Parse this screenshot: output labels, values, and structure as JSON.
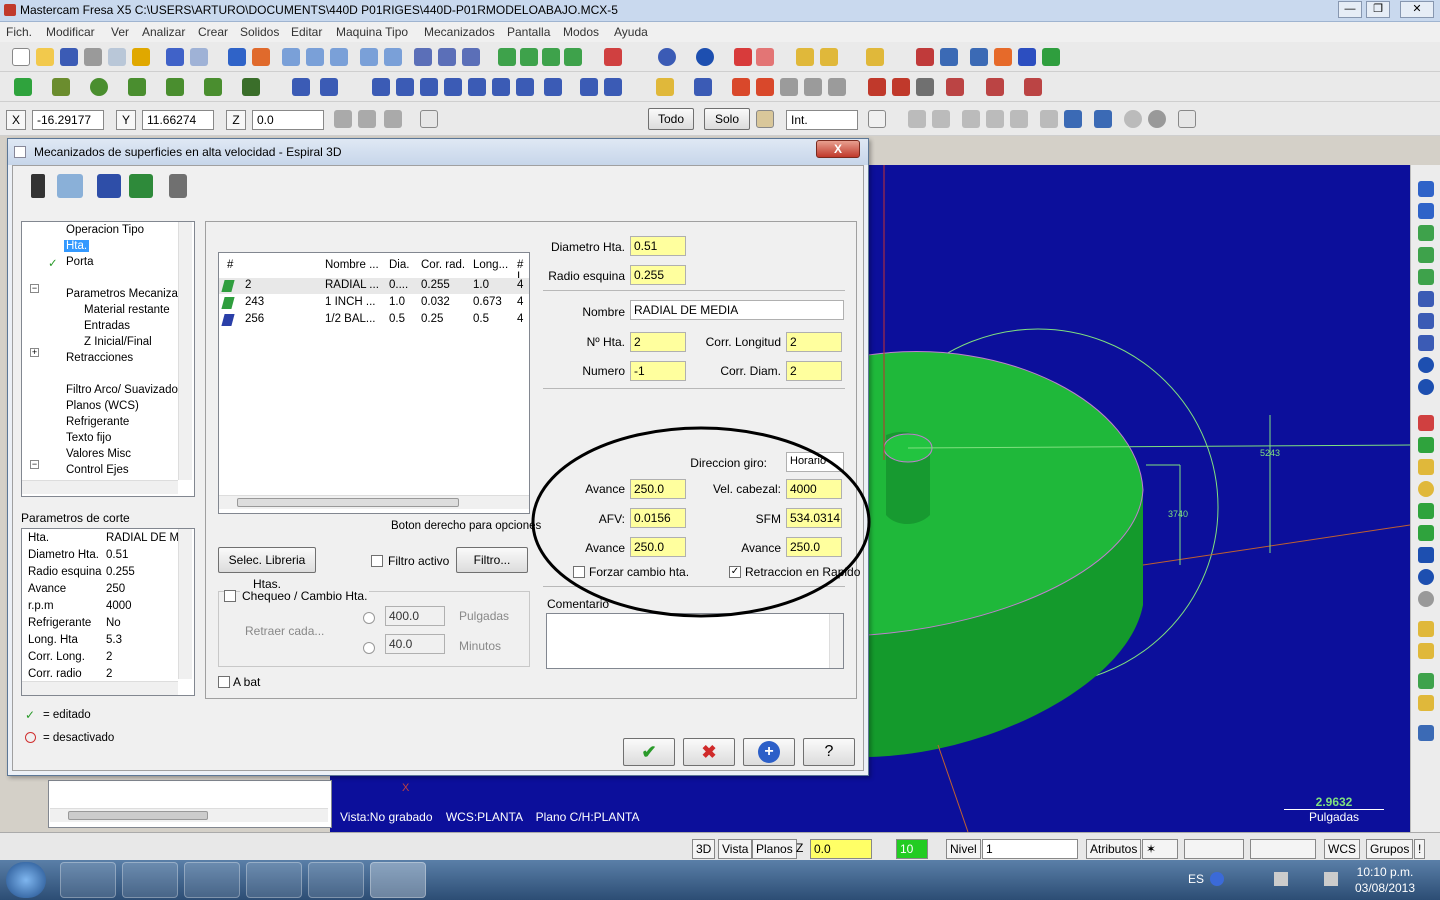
{
  "window": {
    "title": "Mastercam Fresa X5  C:\\USERS\\ARTURO\\DOCUMENTS\\440D P01RIGES\\440D-P01RMODELOABAJO.MCX-5"
  },
  "menu": [
    "Fich.",
    "Modificar",
    "Ver",
    "Analizar",
    "Crear",
    "Solidos",
    "Editar",
    "Maquina Tipo",
    "Mecanizados",
    "Pantalla",
    "Modos",
    "Ayuda"
  ],
  "coords": {
    "x_label": "X",
    "x_value": "-16.29177",
    "y_label": "Y",
    "y_value": "11.66274",
    "z_label": "Z",
    "z_value": "0.0"
  },
  "toolbar3": {
    "todo": "Todo",
    "solo": "Solo",
    "int": "Int."
  },
  "dialog": {
    "title": "Mecanizados de superficies en alta velocidad - Espiral 3D",
    "close": "X",
    "tree": [
      "Operacion Tipo",
      "Hta.",
      "Porta",
      "Parametros Mecanizad",
      "Material restante",
      "Entradas",
      "Z Inicial/Final",
      "Retracciones",
      "Filtro Arco/ Suavizado",
      "Planos (WCS)",
      "Refrigerante",
      "Texto fijo",
      "Valores Misc",
      "Control Ejes"
    ],
    "params_title": "Parametros de corte",
    "params": [
      {
        "k": "Hta.",
        "v": "RADIAL DE M"
      },
      {
        "k": "Diametro Hta.",
        "v": "0.51"
      },
      {
        "k": "Radio esquina",
        "v": "0.255"
      },
      {
        "k": "Avance",
        "v": "250"
      },
      {
        "k": "r.p.m",
        "v": "4000"
      },
      {
        "k": "Refrigerante",
        "v": "No"
      },
      {
        "k": "Long. Hta",
        "v": "5.3"
      },
      {
        "k": "Corr. Long.",
        "v": "2"
      },
      {
        "k": "Corr. radio",
        "v": "2"
      }
    ],
    "legend_edited": "= editado",
    "legend_disabled": "= desactivado",
    "tool_table": {
      "headers": [
        "#",
        "Nombre ...",
        "Dia.",
        "Cor. rad.",
        "Long...",
        "# I"
      ],
      "rows": [
        [
          "2",
          "RADIAL ...",
          "0....",
          "0.255",
          "1.0",
          "4"
        ],
        [
          "243",
          "1 INCH ...",
          "1.0",
          "0.032",
          "0.673",
          "4"
        ],
        [
          "256",
          "1/2 BAL...",
          "0.5",
          "0.25",
          "0.5",
          "4"
        ]
      ]
    },
    "hint": "Boton derecho para opciones",
    "select_library": "Selec. Libreria Htas.",
    "filter_active": "Filtro activo",
    "filter": "Filtro...",
    "check_change": "Chequeo / Cambio Hta.",
    "retract_every": "Retraer cada...",
    "inches_value": "400.0",
    "inches_unit": "Pulgadas",
    "minutes_value": "40.0",
    "minutes_unit": "Minutos",
    "a_bat": "A bat",
    "fields": {
      "diam_label": "Diametro Hta.",
      "diam": "0.51",
      "radio_label": "Radio esquina",
      "radio": "0.255",
      "nombre_label": "Nombre",
      "nombre": "RADIAL DE MEDIA",
      "nhta_label": "Nº Hta.",
      "nhta": "2",
      "corr_long_label": "Corr. Longitud",
      "corr_long": "2",
      "numero_label": "Numero",
      "numero": "-1",
      "corr_diam_label": "Corr. Diam.",
      "corr_diam": "2",
      "dir_label": "Direccion giro:",
      "dir": "Horario",
      "avance_label": "Avance",
      "avance": "250.0",
      "vel_label": "Vel. cabezal:",
      "vel": "4000",
      "afv_label": "AFV:",
      "afv": "0.0156",
      "sfm_label": "SFM",
      "sfm": "534.0314",
      "avance2_label": "Avance",
      "avance2": "250.0",
      "avance3_label": "Avance",
      "avance3": "250.0",
      "forzar": "Forzar cambio hta.",
      "retraccion": "Retraccion en Rapido",
      "comentario": "Comentario"
    }
  },
  "viewport": {
    "dim1": "5243",
    "dim2": "3740",
    "scale_value": "2.9632",
    "scale_unit": "Pulgadas",
    "info": "Vista:No grabado    WCS:PLANTA    Plano C/H:PLANTA",
    "axis_x": "X"
  },
  "statusbar": {
    "b3d": "3D",
    "vista": "Vista",
    "planos": "Planos",
    "z": "Z",
    "z_value": "0.0",
    "color": "10",
    "nivel": "Nivel",
    "nivel_value": "1",
    "atributos": "Atributos",
    "wcs": "WCS",
    "grupos": "Grupos",
    "excl": "!"
  },
  "taskbar": {
    "lang": "ES",
    "time": "10:10 p.m.",
    "date": "03/08/2013"
  },
  "colors": {
    "viewport": "#0c0f9b",
    "part": "#1fb83a",
    "highlight": "#ffff9e"
  }
}
